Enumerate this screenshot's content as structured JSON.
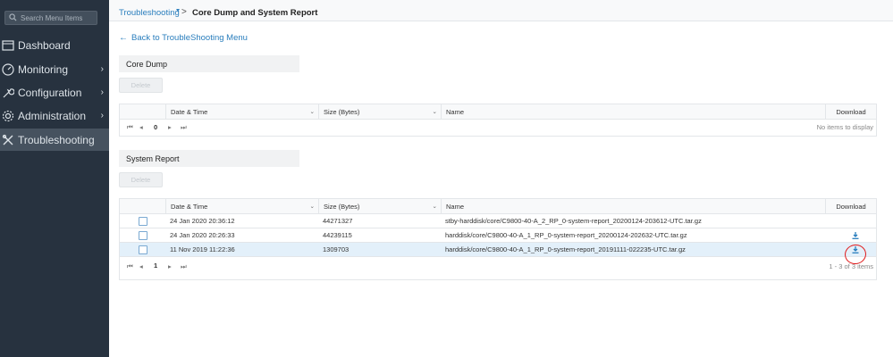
{
  "sidebar": {
    "search_placeholder": "Search Menu Items",
    "items": [
      {
        "label": "Dashboard",
        "icon": "dashboard-icon",
        "chevron": ""
      },
      {
        "label": "Monitoring",
        "icon": "monitoring-icon",
        "chevron": "›"
      },
      {
        "label": "Configuration",
        "icon": "wrench-icon",
        "chevron": "›"
      },
      {
        "label": "Administration",
        "icon": "gear-icon",
        "chevron": "›"
      },
      {
        "label": "Troubleshooting",
        "icon": "tools-icon",
        "chevron": ""
      }
    ],
    "active_color": "#46525f",
    "background": "#27323f"
  },
  "header": {
    "breadcrumb_parent": "Troubleshooting",
    "breadcrumb_separator": ">",
    "title": "Core Dump and System Report"
  },
  "back_link": "Back to TroubleShooting Menu",
  "core_dump": {
    "title": "Core Dump",
    "delete_label": "Delete",
    "columns": {
      "date": "Date & Time",
      "size": "Size (Bytes)",
      "name": "Name",
      "download": "Download"
    },
    "pager": {
      "page": "0",
      "status": "No items to display"
    }
  },
  "system_report": {
    "title": "System Report",
    "delete_label": "Delete",
    "columns": {
      "date": "Date & Time",
      "size": "Size (Bytes)",
      "name": "Name",
      "download": "Download"
    },
    "rows": [
      {
        "date": "24 Jan 2020 20:36:12",
        "size": "44271327",
        "name": "stby-harddisk/core/C9800-40-A_2_RP_0-system-report_20200124-203612-UTC.tar.gz",
        "download": false,
        "selected": false
      },
      {
        "date": "24 Jan 2020 20:26:33",
        "size": "44239115",
        "name": "harddisk/core/C9800-40-A_1_RP_0-system-report_20200124-202632-UTC.tar.gz",
        "download": true,
        "selected": false
      },
      {
        "date": "11 Nov 2019 11:22:36",
        "size": "1309703",
        "name": "harddisk/core/C9800-40-A_1_RP_0-system-report_20191111-022235-UTC.tar.gz",
        "download": true,
        "selected": true
      }
    ],
    "pager": {
      "page": "1",
      "status": "1 - 3 of 3 items"
    }
  },
  "colors": {
    "link": "#2a7ebd",
    "highlight": "#e3f0fa",
    "annotation": "#e0191a"
  }
}
